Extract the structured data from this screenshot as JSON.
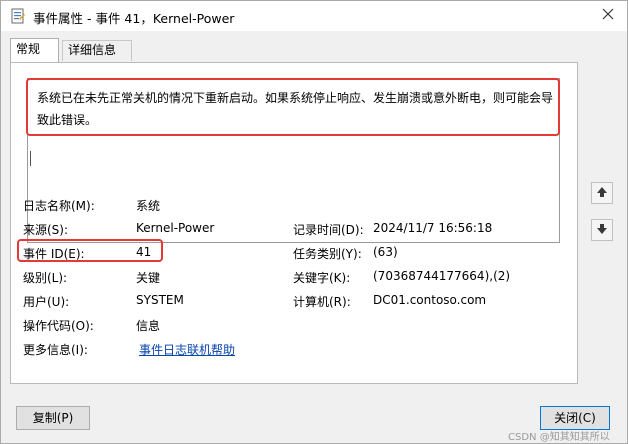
{
  "window": {
    "title": "事件属性 - 事件 41，Kernel-Power"
  },
  "tabs": [
    {
      "label": "常规",
      "active": true
    },
    {
      "label": "详细信息",
      "active": false
    }
  ],
  "description": "系统已在未先正常关机的情况下重新启动。如果系统停止响应、发生崩溃或意外断电，则可能会导致此错误。",
  "fields": {
    "log_name": {
      "label": "日志名称(M):",
      "value": "系统"
    },
    "source": {
      "label": "来源(S):",
      "value": "Kernel-Power"
    },
    "logged": {
      "label": "记录时间(D):",
      "value": "2024/11/7 16:56:18"
    },
    "event_id": {
      "label": "事件 ID(E):",
      "value": "41"
    },
    "task_category": {
      "label": "任务类别(Y):",
      "value": "(63)"
    },
    "level": {
      "label": "级别(L):",
      "value": "关键"
    },
    "keywords": {
      "label": "关键字(K):",
      "value": "(70368744177664),(2)"
    },
    "user": {
      "label": "用户(U):",
      "value": "SYSTEM"
    },
    "computer": {
      "label": "计算机(R):",
      "value": "DC01.contoso.com"
    },
    "opcode": {
      "label": "操作代码(O):",
      "value": "信息"
    },
    "more_info": {
      "label": "更多信息(I):",
      "value": "事件日志联机帮助"
    }
  },
  "buttons": {
    "copy": "复制(P)",
    "close": "关闭(C)"
  },
  "watermark": "CSDN @知其知其所以",
  "colors": {
    "highlight": "#e53935",
    "link": "#0645ad"
  },
  "icons": {
    "app": "event-properties-icon",
    "close": "close-icon",
    "up": "arrow-up-icon",
    "down": "arrow-down-icon"
  }
}
